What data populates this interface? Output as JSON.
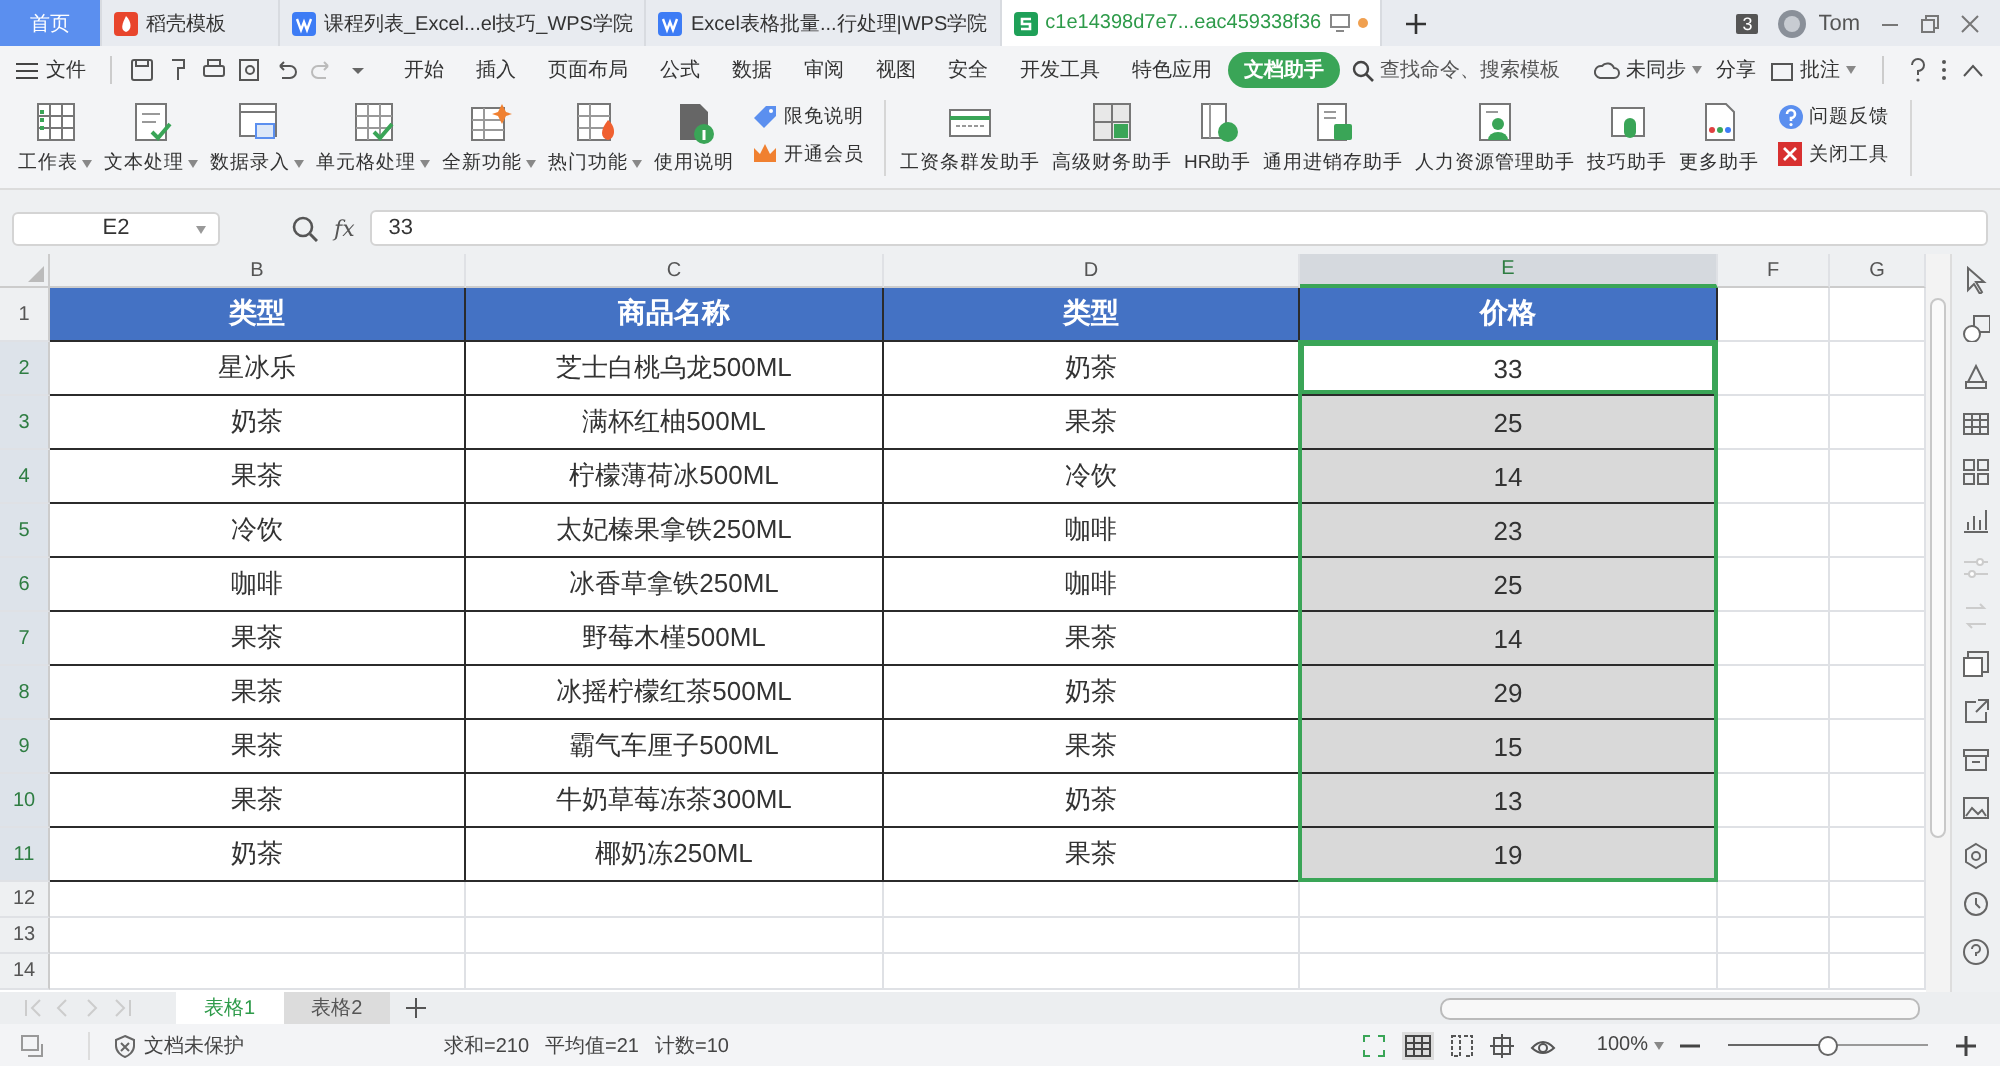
{
  "title_tabs": [
    {
      "label": "首页",
      "kind": "home",
      "selected": false
    },
    {
      "label": "稻壳模板",
      "kind": "docer",
      "selected": false
    },
    {
      "label": "课程列表_Excel...el技巧_WPS学院",
      "kind": "web",
      "selected": false
    },
    {
      "label": "Excel表格批量...行处理|WPS学院",
      "kind": "web",
      "selected": false
    },
    {
      "label": "c1e14398d7e7...eac459338f36",
      "kind": "sheet",
      "selected": true
    }
  ],
  "window_badge": "3",
  "user": "Tom",
  "menu": {
    "file": "文件",
    "tabs": [
      {
        "label": "开始",
        "selected": false
      },
      {
        "label": "插入",
        "selected": false
      },
      {
        "label": "页面布局",
        "selected": false
      },
      {
        "label": "公式",
        "selected": false
      },
      {
        "label": "数据",
        "selected": false
      },
      {
        "label": "审阅",
        "selected": false
      },
      {
        "label": "视图",
        "selected": false
      },
      {
        "label": "安全",
        "selected": false
      },
      {
        "label": "开发工具",
        "selected": false
      },
      {
        "label": "特色应用",
        "selected": false
      },
      {
        "label": "文档助手",
        "selected": true
      }
    ],
    "search": "查找命令、搜索模板",
    "sync": "未同步",
    "share": "分享",
    "comment": "批注"
  },
  "ribbon": [
    {
      "kind": "big",
      "label": "工作表",
      "dropdown": true
    },
    {
      "kind": "big",
      "label": "文本处理",
      "dropdown": true
    },
    {
      "kind": "big",
      "label": "数据录入",
      "dropdown": true
    },
    {
      "kind": "big",
      "label": "单元格处理",
      "dropdown": true
    },
    {
      "kind": "big",
      "label": "全新功能",
      "dropdown": true
    },
    {
      "kind": "big",
      "label": "热门功能",
      "dropdown": true
    },
    {
      "kind": "big",
      "label": "使用说明",
      "dropdown": false
    },
    {
      "kind": "small",
      "items": [
        "限免说明",
        "开通会员"
      ]
    },
    {
      "kind": "big",
      "label": "工资条群发助手",
      "dropdown": false
    },
    {
      "kind": "big",
      "label": "高级财务助手",
      "dropdown": false
    },
    {
      "kind": "big",
      "label": "HR助手",
      "dropdown": false
    },
    {
      "kind": "big",
      "label": "通用进销存助手",
      "dropdown": false
    },
    {
      "kind": "big",
      "label": "人力资源管理助手",
      "dropdown": false
    },
    {
      "kind": "big",
      "label": "技巧助手",
      "dropdown": false
    },
    {
      "kind": "big",
      "label": "更多助手",
      "dropdown": false
    },
    {
      "kind": "small",
      "items": [
        "问题反馈",
        "关闭工具"
      ]
    }
  ],
  "formula_bar": {
    "cell": "E2",
    "fx": "fx",
    "value": "33"
  },
  "grid": {
    "columns": [
      {
        "label": "B",
        "selected": false
      },
      {
        "label": "C",
        "selected": false
      },
      {
        "label": "D",
        "selected": false
      },
      {
        "label": "E",
        "selected": true
      },
      {
        "label": "F",
        "selected": false
      },
      {
        "label": "G",
        "selected": false
      }
    ],
    "rows": [
      {
        "number": "1",
        "kind": "header",
        "selected": false,
        "cells": [
          "类型",
          "商品名称",
          "类型",
          "价格"
        ]
      },
      {
        "number": "2",
        "kind": "data",
        "selected": true,
        "active": true,
        "cells": [
          "星冰乐",
          "芝士白桃乌龙500ML",
          "奶茶",
          "33"
        ]
      },
      {
        "number": "3",
        "kind": "data",
        "selected": true,
        "active": false,
        "cells": [
          "奶茶",
          "满杯红柚500ML",
          "果茶",
          "25"
        ]
      },
      {
        "number": "4",
        "kind": "data",
        "selected": true,
        "active": false,
        "cells": [
          "果茶",
          "柠檬薄荷冰500ML",
          "冷饮",
          "14"
        ]
      },
      {
        "number": "5",
        "kind": "data",
        "selected": true,
        "active": false,
        "cells": [
          "冷饮",
          "太妃榛果拿铁250ML",
          "咖啡",
          "23"
        ]
      },
      {
        "number": "6",
        "kind": "data",
        "selected": true,
        "active": false,
        "cells": [
          "咖啡",
          "冰香草拿铁250ML",
          "咖啡",
          "25"
        ]
      },
      {
        "number": "7",
        "kind": "data",
        "selected": true,
        "active": false,
        "cells": [
          "果茶",
          "野莓木槿500ML",
          "果茶",
          "14"
        ]
      },
      {
        "number": "8",
        "kind": "data",
        "selected": true,
        "active": false,
        "cells": [
          "果茶",
          "冰摇柠檬红茶500ML",
          "奶茶",
          "29"
        ]
      },
      {
        "number": "9",
        "kind": "data",
        "selected": true,
        "active": false,
        "cells": [
          "果茶",
          "霸气车厘子500ML",
          "果茶",
          "15"
        ]
      },
      {
        "number": "10",
        "kind": "data",
        "selected": true,
        "active": false,
        "cells": [
          "果茶",
          "牛奶草莓冻茶300ML",
          "奶茶",
          "13"
        ]
      },
      {
        "number": "11",
        "kind": "data",
        "selected": true,
        "active": false,
        "cells": [
          "奶茶",
          "椰奶冻250ML",
          "果茶",
          "19"
        ]
      },
      {
        "number": "12",
        "kind": "empty",
        "selected": false
      },
      {
        "number": "13",
        "kind": "empty",
        "selected": false
      },
      {
        "number": "14",
        "kind": "empty",
        "selected": false
      }
    ]
  },
  "sheet_tabs": [
    {
      "label": "表格1",
      "selected": true
    },
    {
      "label": "表格2",
      "selected": false
    }
  ],
  "status_bar": {
    "protect": "文档未保护",
    "stats": [
      "求和=210",
      "平均值=21",
      "计数=10"
    ],
    "zoom": "100%",
    "level": 0.5
  }
}
